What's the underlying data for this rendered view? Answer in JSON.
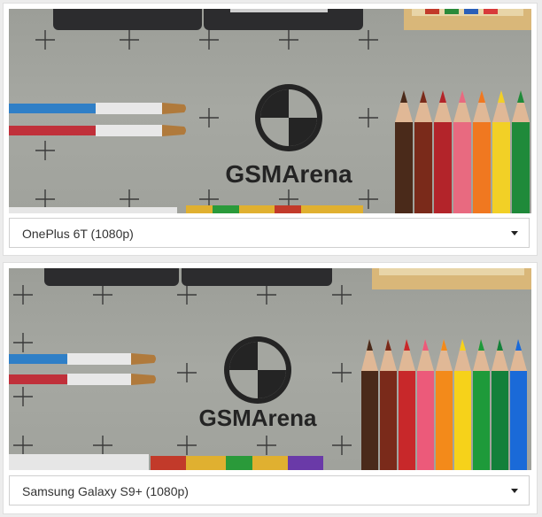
{
  "comparisons": [
    {
      "selected_device": "OnePlus 6T (1080p)",
      "logo_text": "GSMArena"
    },
    {
      "selected_device": "Samsung Galaxy S9+ (1080p)",
      "logo_text": "GSMArena"
    }
  ],
  "icons": {
    "dropdown": "caret-down-icon"
  },
  "colors": {
    "page_background": "#ececec",
    "panel_background": "#ffffff",
    "photo_gray": "#a4a6a0"
  }
}
